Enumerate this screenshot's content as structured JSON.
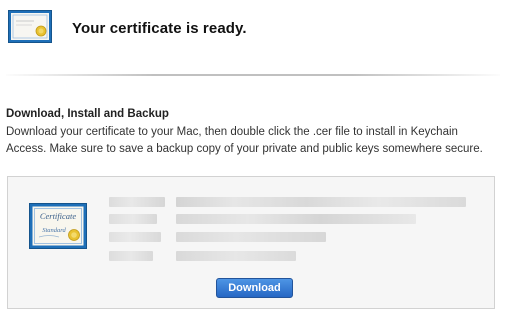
{
  "header": {
    "icon": "certificate-icon",
    "title": "Your certificate is ready."
  },
  "section": {
    "title": "Download, Install and Backup",
    "description": "Download your certificate to your Mac, then double click the .cer file to install in Keychain Access. Make sure to save a backup copy of your private and public keys somewhere secure."
  },
  "card": {
    "icon": "certificate-standard-icon",
    "badge_text_top": "Certificate",
    "badge_text_bottom": "Standard",
    "download_label": "Download"
  },
  "colors": {
    "button_top": "#4e95e5",
    "button_bottom": "#2667c4",
    "card_background": "#f6f6f6",
    "certificate_border": "#1e6fb8",
    "seal_gold": "#e8c232"
  }
}
